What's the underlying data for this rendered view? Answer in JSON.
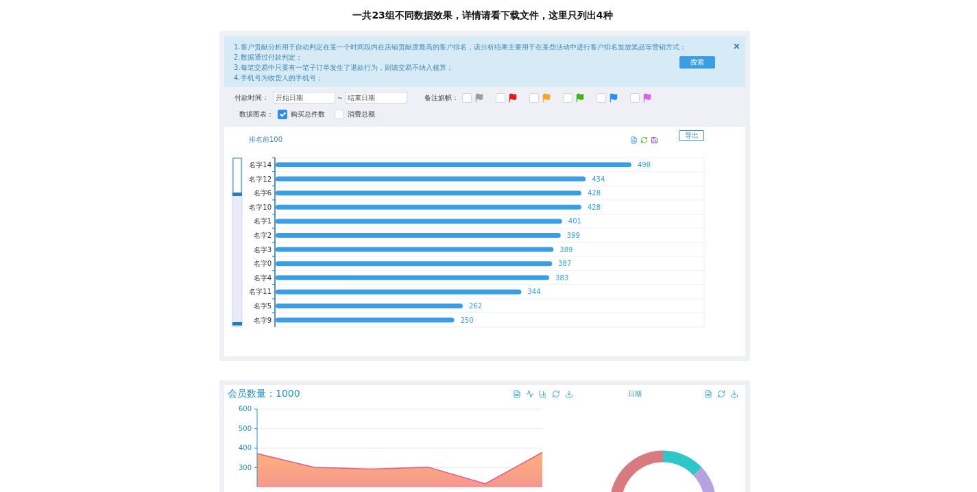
{
  "page_title": "一共23组不同数据效果，详情请看下载文件，这里只列出4种",
  "ranking_panel": {
    "notice": {
      "lines": [
        "1.客户贡献分析用于自动判定在某一个时间段内在店铺贡献度最高的客户排名，该分析结果主要用于在某些活动中进行客户排名发放奖品等营销方式；",
        "2.数据通过付款判定；",
        "3.每笔交易中只要有一笔子订单发生了退款行为，则该交易不纳入核算；",
        "4.手机号为收货人的手机号；"
      ],
      "search_button": "搜索"
    },
    "filters": {
      "date_label": "付款时间：",
      "start_placeholder": "开始日期",
      "separator": "~",
      "end_placeholder": "结束日期",
      "flag_label": "备注旗帜：",
      "flags": [
        {
          "color": "#9e9e9e",
          "checked": false
        },
        {
          "color": "#e31a1a",
          "checked": false
        },
        {
          "color": "#f5a623",
          "checked": false
        },
        {
          "color": "#3fb618",
          "checked": false
        },
        {
          "color": "#2f8ef0",
          "checked": false
        },
        {
          "color": "#d966e6",
          "checked": false
        }
      ]
    },
    "chart_type": {
      "label": "数据图表：",
      "options": [
        {
          "label": "购买总件数",
          "checked": true
        },
        {
          "label": "消费总额",
          "checked": false
        }
      ]
    },
    "chart_card": {
      "title": "排名前100",
      "export_button": "导出",
      "chart_data": {
        "type": "bar",
        "orientation": "horizontal",
        "categories": [
          "名字14",
          "名字12",
          "名字6",
          "名字10",
          "名字1",
          "名字2",
          "名字3",
          "名字0",
          "名字4",
          "名字11",
          "名字5",
          "名字9"
        ],
        "values": [
          498,
          434,
          428,
          428,
          401,
          399,
          389,
          387,
          383,
          344,
          262,
          250
        ],
        "data_labels": true
      }
    }
  },
  "member_panel": {
    "title_label": "会员数量：",
    "title_value": "1000",
    "chart_data": {
      "type": "area",
      "categories": [
        null,
        null,
        null,
        null,
        null,
        null
      ],
      "ylim": [
        200,
        600
      ],
      "yticks": [
        300,
        400,
        500,
        600
      ],
      "grid": true,
      "series": [
        {
          "color": "#e8578a",
          "values": [
            372,
            302,
            293,
            303,
            218,
            378
          ]
        }
      ]
    },
    "donut_title": "日期"
  }
}
